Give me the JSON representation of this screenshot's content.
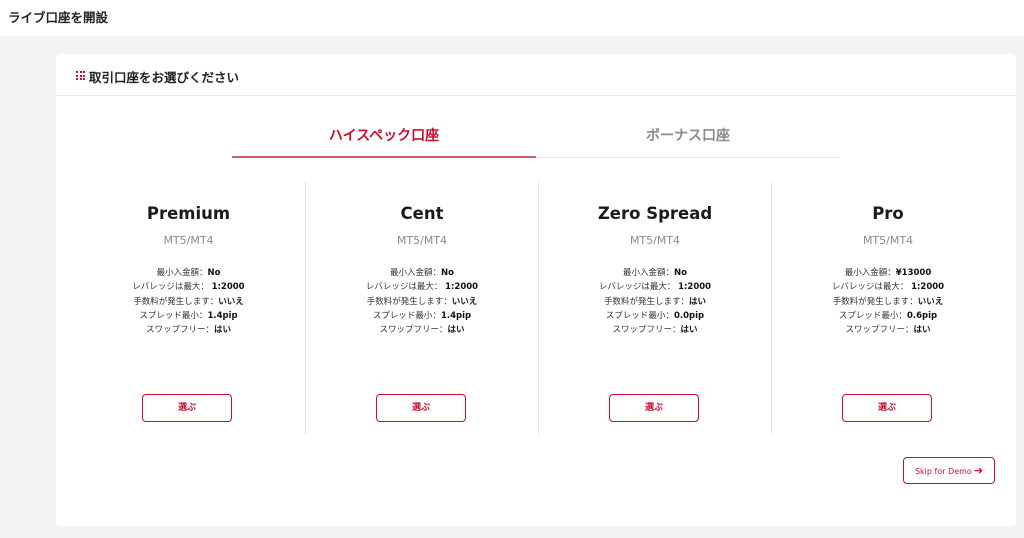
{
  "page": {
    "title": "ライブ口座を開設"
  },
  "card": {
    "title": "取引口座をお選びください",
    "icon": "grid-icon"
  },
  "tabs": [
    {
      "label": "ハイスペック口座",
      "active": true
    },
    {
      "label": "ボーナス口座",
      "active": false
    }
  ],
  "plans": [
    {
      "name": "Premium",
      "platform": "MT5/MT4",
      "min_deposit_label": "最小入金額：",
      "min_deposit": "No",
      "leverage_label": "レバレッジは最大： ",
      "leverage": "1:2000",
      "commission_label": "手数料が発生します：",
      "commission": "いいえ",
      "spread_label": "スプレッド最小：",
      "spread": "1.4pip",
      "swap_free_label": "スワップフリー：",
      "swap_free": "はい",
      "button": "選ぶ"
    },
    {
      "name": "Cent",
      "platform": "MT5/MT4",
      "min_deposit_label": "最小入金額：",
      "min_deposit": "No",
      "leverage_label": "レバレッジは最大： ",
      "leverage": "1:2000",
      "commission_label": "手数料が発生します：",
      "commission": "いいえ",
      "spread_label": "スプレッド最小：",
      "spread": "1.4pip",
      "swap_free_label": "スワップフリー：",
      "swap_free": "はい",
      "button": "選ぶ"
    },
    {
      "name": "Zero Spread",
      "platform": "MT5/MT4",
      "min_deposit_label": "最小入金額：",
      "min_deposit": "No",
      "leverage_label": "レバレッジは最大： ",
      "leverage": "1:2000",
      "commission_label": "手数料が発生します：",
      "commission": "はい",
      "spread_label": "スプレッド最小：",
      "spread": "0.0pip",
      "swap_free_label": "スワップフリー：",
      "swap_free": "はい",
      "button": "選ぶ"
    },
    {
      "name": "Pro",
      "platform": "MT5/MT4",
      "min_deposit_label": "最小入金額：",
      "min_deposit": "¥13000",
      "leverage_label": "レバレッジは最大： ",
      "leverage": "1:2000",
      "commission_label": "手数料が発生します：",
      "commission": "いいえ",
      "spread_label": "スプレッド最小：",
      "spread": "0.6pip",
      "swap_free_label": "スワップフリー：",
      "swap_free": "はい",
      "button": "選ぶ"
    }
  ],
  "skip_demo": {
    "label": "Skip for Demo",
    "icon": "arrow-right-icon"
  },
  "colors": {
    "accent": "#c8102e",
    "background": "#f3f3f3",
    "card": "#ffffff"
  }
}
